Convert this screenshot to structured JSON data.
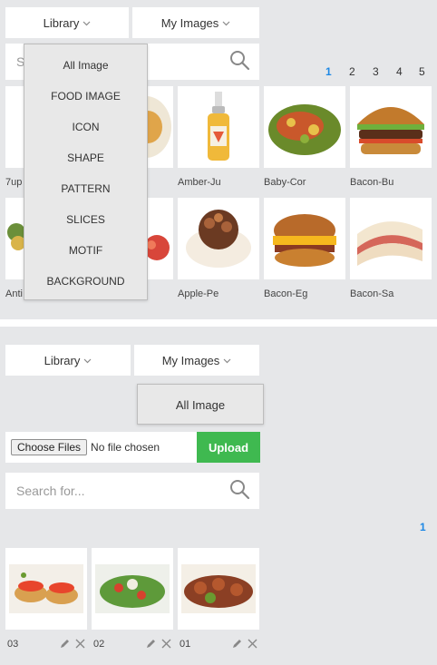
{
  "top": {
    "tabs": {
      "library": "Library",
      "my_images": "My Images"
    },
    "search_placeholder": "S",
    "pagination": [
      "1",
      "2",
      "3",
      "4",
      "5"
    ],
    "active_page": "1",
    "library_menu": [
      "All Image",
      "FOOD IMAGE",
      "ICON",
      "SHAPE",
      "PATTERN",
      "SLICES",
      "MOTIF",
      "BACKGROUND"
    ],
    "images_row1": [
      "7up",
      "",
      "Amber-Ju",
      "Baby-Cor",
      "Bacon-Bu"
    ],
    "images_row2": [
      "Anti",
      "",
      "Apple-Pe",
      "Bacon-Eg",
      "Bacon-Sa"
    ]
  },
  "bottom": {
    "tabs": {
      "library": "Library",
      "my_images": "My Images"
    },
    "my_images_menu": [
      "All Image"
    ],
    "file": {
      "choose_label": "Choose Files",
      "status": "No file chosen",
      "upload_label": "Upload"
    },
    "search_placeholder": "Search for...",
    "pagination": [
      "1"
    ],
    "uploads": [
      "03",
      "02",
      "01"
    ]
  },
  "colors": {
    "accent_blue": "#1e88e5",
    "upload_green": "#3fb950",
    "page_bg": "#e6e7e9"
  }
}
